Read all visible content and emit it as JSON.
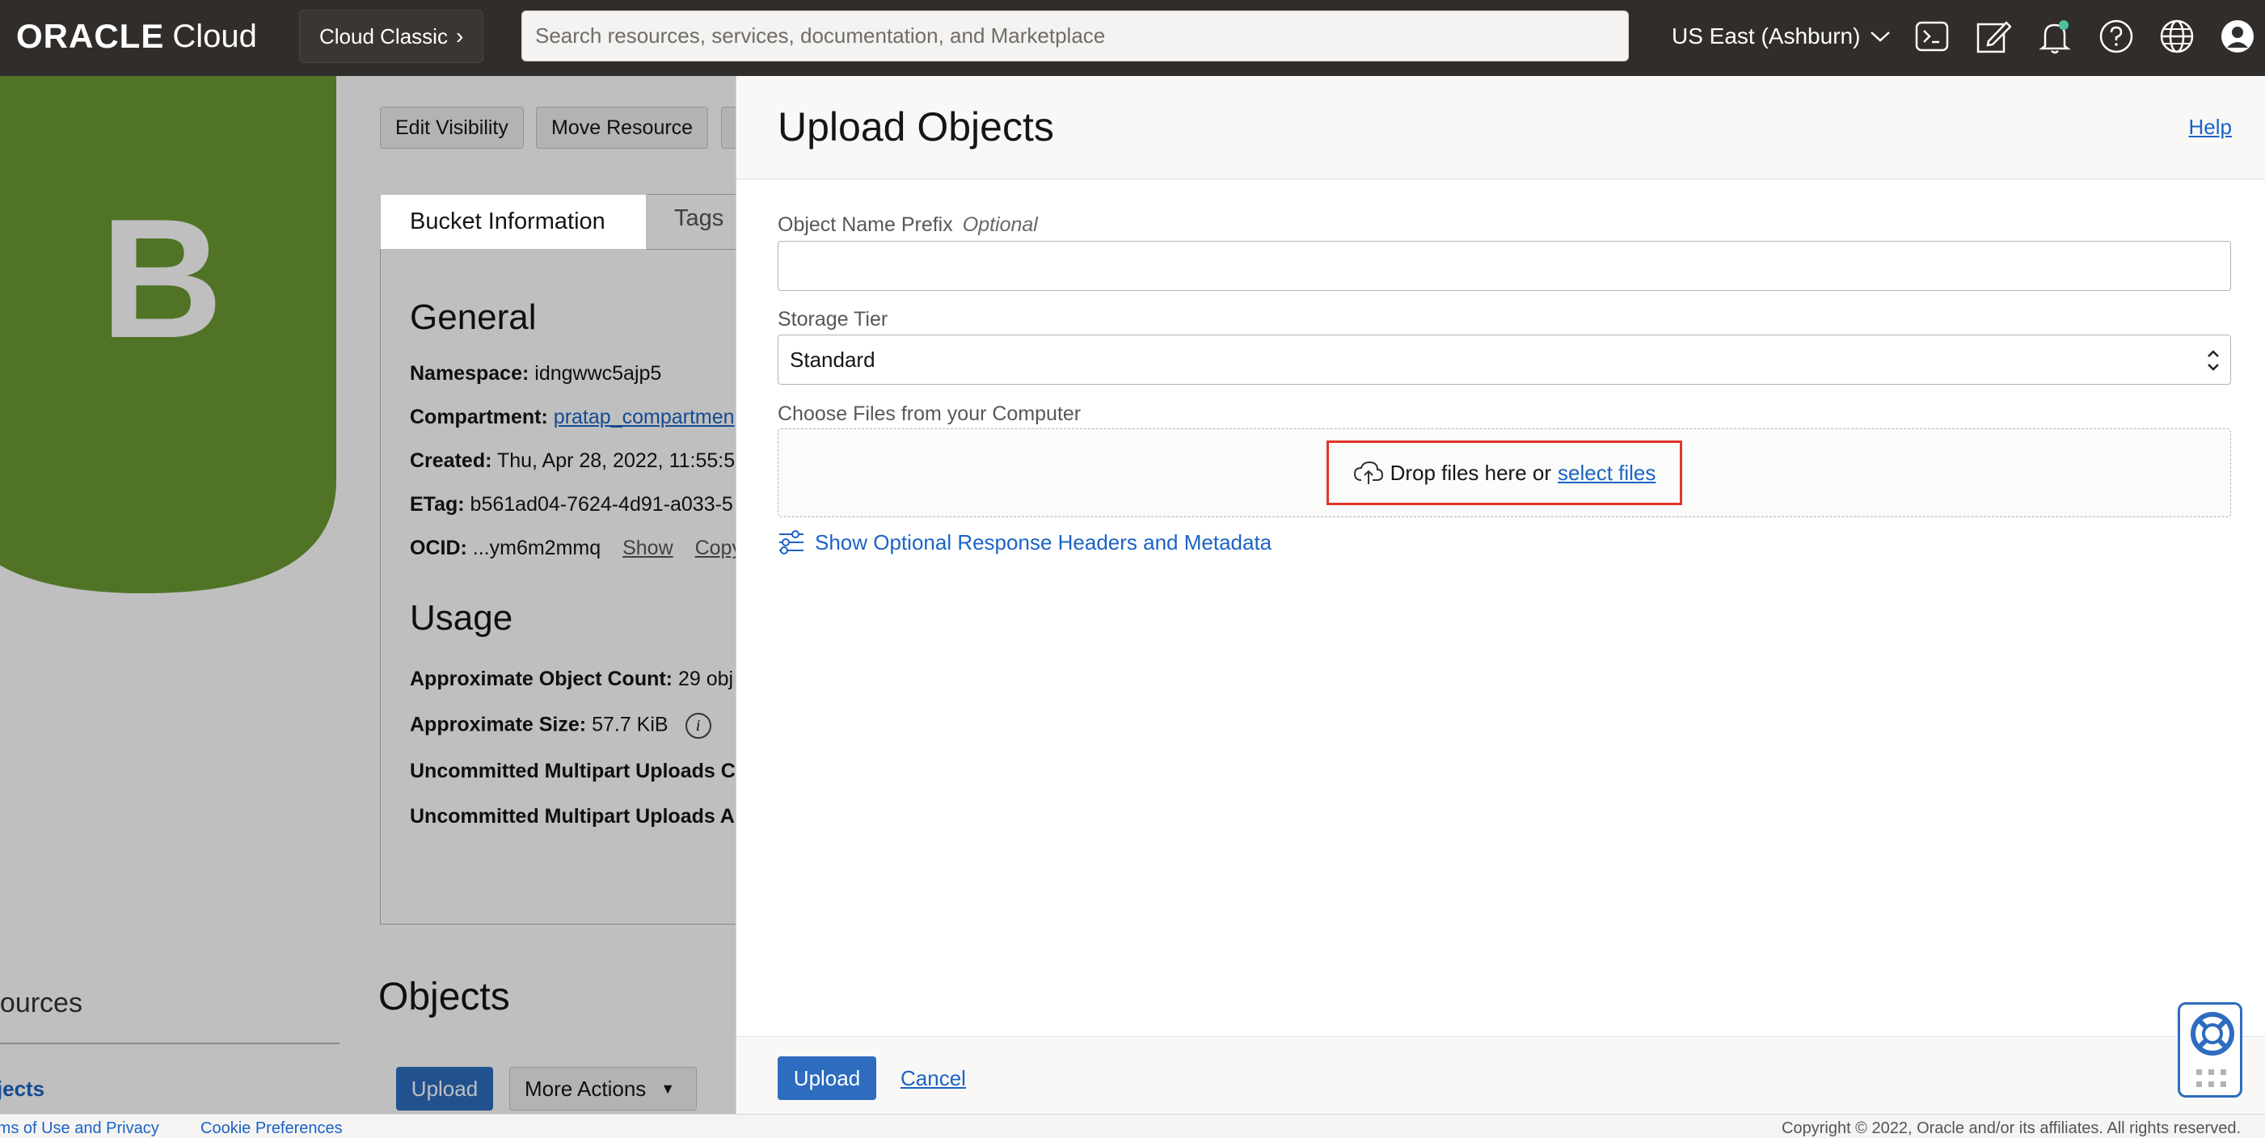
{
  "topbar": {
    "logo_oracle": "ORACLE",
    "logo_cloud": "Cloud",
    "classic_label": "Cloud Classic",
    "search_placeholder": "Search resources, services, documentation, and Marketplace",
    "region": "US East (Ashburn)"
  },
  "bucket": {
    "letter": "B",
    "actions": [
      "Edit Visibility",
      "Move Resource"
    ],
    "tabs": [
      "Bucket Information",
      "Tags"
    ],
    "general_heading": "General",
    "namespace_label": "Namespace:",
    "namespace_value": "idngwwc5ajp5",
    "compartment_label": "Compartment:",
    "compartment_value": "pratap_compartmen",
    "created_label": "Created:",
    "created_value": "Thu, Apr 28, 2022, 11:55:5",
    "etag_label": "ETag:",
    "etag_value": "b561ad04-7624-4d91-a033-5",
    "ocid_label": "OCID:",
    "ocid_value": "...ym6m2mmq",
    "ocid_show": "Show",
    "ocid_copy": "Copy",
    "usage_heading": "Usage",
    "object_count_label": "Approximate Object Count:",
    "object_count_value": "29 obj",
    "size_label": "Approximate Size:",
    "size_value": "57.7 KiB",
    "multipart_count_label": "Uncommitted Multipart Uploads C",
    "multipart_size_label": "Uncommitted Multipart Uploads A",
    "objects_heading": "Objects",
    "upload_label": "Upload",
    "more_actions_label": "More Actions",
    "resources_heading": "esources",
    "resources_link": "bjects"
  },
  "footer": {
    "terms": "rms of Use and Privacy",
    "cookies": "Cookie Preferences",
    "copyright": "Copyright © 2022, Oracle and/or its affiliates. All rights reserved."
  },
  "drawer": {
    "title": "Upload Objects",
    "help": "Help",
    "prefix_label": "Object Name Prefix",
    "prefix_optional": "Optional",
    "prefix_value": "",
    "tier_label": "Storage Tier",
    "tier_value": "Standard",
    "files_label": "Choose Files from your Computer",
    "drop_text": "Drop files here or",
    "select_files": "select files",
    "optional_headers": "Show Optional Response Headers and Metadata",
    "upload_button": "Upload",
    "cancel_button": "Cancel"
  },
  "colors": {
    "topbar": "#312d2a",
    "bucket_green": "#6b9a33",
    "link_blue": "#1b63c6",
    "primary_button": "#2d6cbf",
    "highlight_red": "#e0352b"
  },
  "icons": [
    "cloud-shell-icon",
    "edit-icon",
    "notification-bell-icon",
    "help-icon",
    "language-globe-icon",
    "user-avatar-icon",
    "upload-cloud-icon",
    "settings-sliders-icon",
    "support-lifebuoy-icon"
  ]
}
